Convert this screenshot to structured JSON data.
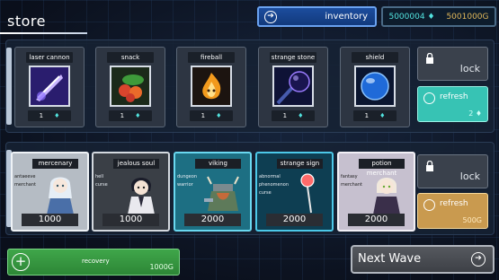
{
  "header": {
    "title": "store"
  },
  "inventory": {
    "label": "inventory"
  },
  "currency": {
    "gems": "5000004",
    "gold": "5001000G"
  },
  "shop_items": [
    {
      "name": "laser cannon",
      "price": "1"
    },
    {
      "name": "snack",
      "price": "1"
    },
    {
      "name": "fireball",
      "price": "1"
    },
    {
      "name": "strange stone",
      "price": "1"
    },
    {
      "name": "shield",
      "price": "1"
    }
  ],
  "shop_lock": {
    "label": "lock"
  },
  "shop_refresh": {
    "label": "refresh",
    "cost": "2"
  },
  "mercenaries": [
    {
      "name": "mercenary",
      "traits": [
        "antaeeve",
        "merchant"
      ],
      "cost": "1000"
    },
    {
      "name": "jealous soul",
      "traits": [
        "hell",
        "curse"
      ],
      "cost": "1000"
    },
    {
      "name": "viking",
      "traits": [
        "dungeon",
        "warrior"
      ],
      "cost": "2000"
    },
    {
      "name": "strange sign",
      "traits": [
        "abnormal",
        "phenomenon",
        "curse"
      ],
      "cost": "2000"
    },
    {
      "name": "potion merchant",
      "traits": [
        "fantasy",
        "merchant"
      ],
      "cost": "2000"
    }
  ],
  "merc_lock": {
    "label": "lock"
  },
  "merc_refresh": {
    "label": "refresh",
    "cost": "500G"
  },
  "recovery": {
    "label": "recovery",
    "cost": "1000G"
  },
  "next_wave": {
    "label": "Next Wave"
  }
}
